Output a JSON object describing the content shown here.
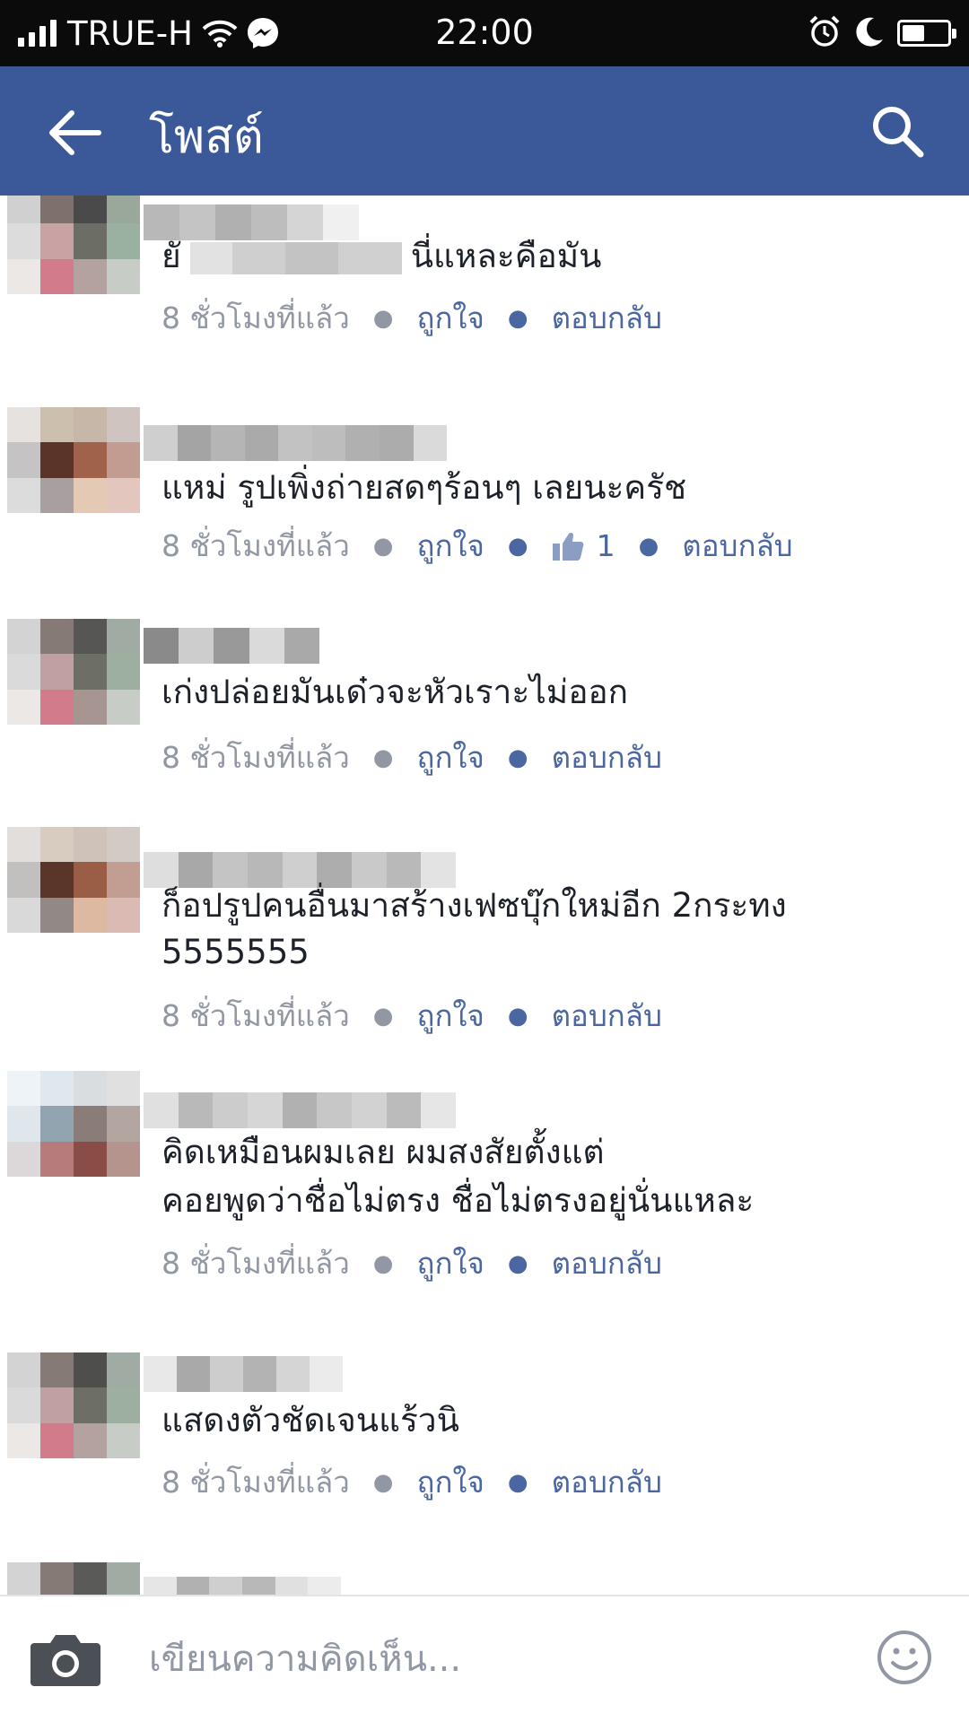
{
  "status_bar": {
    "carrier": "TRUE-H",
    "time": "22:00",
    "battery_level": 0.5
  },
  "header": {
    "title": "โพสต์"
  },
  "comments": [
    {
      "text_prefix": "ยั",
      "text": "นี่แหละคือมัน",
      "time": "8 ชั่วโมงที่แล้ว",
      "like_label": "ถูกใจ",
      "reply_label": "ตอบกลับ"
    },
    {
      "text": "แหม่ รูปเพิ่งถ่ายสดๆร้อนๆ เลยนะครัช",
      "time": "8 ชั่วโมงที่แล้ว",
      "like_label": "ถูกใจ",
      "like_count": "1",
      "reply_label": "ตอบกลับ"
    },
    {
      "text": "เก่งปล่อยมันเด๋วจะหัวเราะไม่ออก",
      "time": "8 ชั่วโมงที่แล้ว",
      "like_label": "ถูกใจ",
      "reply_label": "ตอบกลับ"
    },
    {
      "text_lines": [
        "ก็อปรูปคนอื่นมาสร้างเฟซบุ๊กใหม่อีก 2กระทง",
        "5555555"
      ],
      "time": "8 ชั่วโมงที่แล้ว",
      "like_label": "ถูกใจ",
      "reply_label": "ตอบกลับ"
    },
    {
      "text_lines": [
        "คิดเหมือนผมเลย ผมสงสัยตั้งแต่",
        "คอยพูดว่าชื่อไม่ตรง ชื่อไม่ตรงอยู่นั่นแหละ"
      ],
      "time": "8 ชั่วโมงที่แล้ว",
      "like_label": "ถูกใจ",
      "reply_label": "ตอบกลับ"
    },
    {
      "text": "แสดงตัวชัดเจนแร้วนิ",
      "time": "8 ชั่วโมงที่แล้ว",
      "like_label": "ถูกใจ",
      "reply_label": "ตอบกลับ"
    }
  ],
  "composer": {
    "placeholder": "เขียนความคิดเห็น..."
  },
  "icons": {
    "signal": "signal-bars-icon",
    "wifi": "wifi-icon",
    "messenger": "messenger-icon",
    "alarm": "alarm-clock-icon",
    "do_not_disturb": "moon-icon",
    "battery": "battery-icon",
    "back": "arrow-left-icon",
    "search": "search-icon",
    "thumbs_up": "thumbs-up-icon",
    "camera": "camera-icon",
    "emoji": "smiley-icon"
  },
  "colors": {
    "brand": "#3b5998",
    "status_bar": "#0b0b0b",
    "link": "#4b67a1",
    "meta_text": "#9197a3",
    "body_text": "#1d2129"
  }
}
